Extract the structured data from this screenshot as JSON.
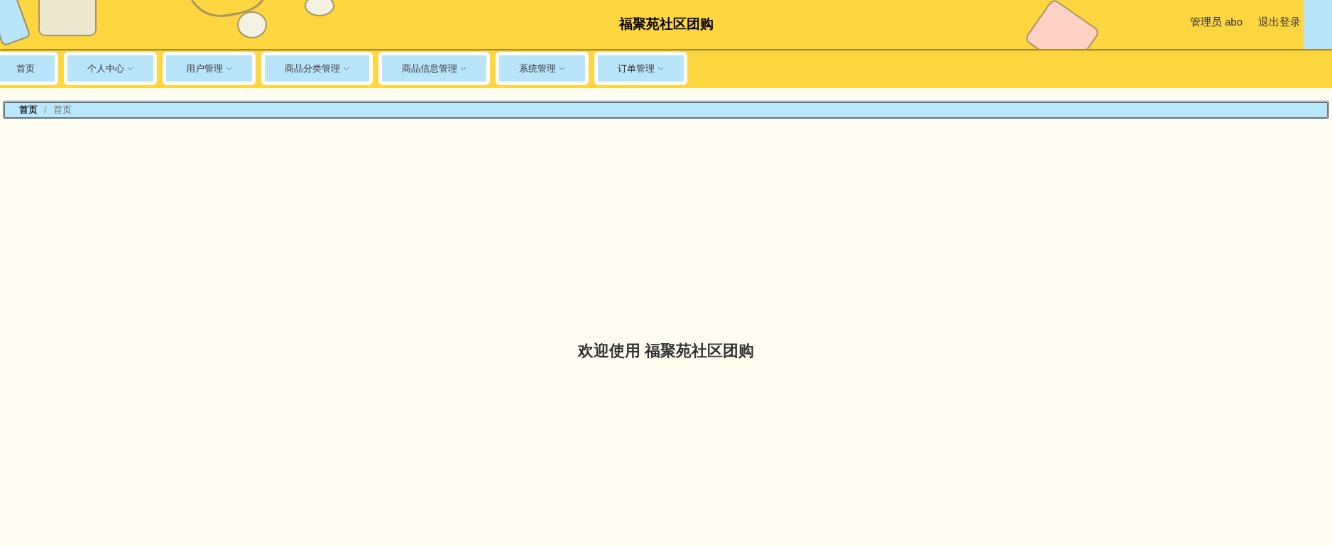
{
  "header": {
    "title": "福聚苑社区团购",
    "user": "管理员 abo",
    "logout": "退出登录"
  },
  "menu": [
    {
      "label": "首页",
      "dropdown": false
    },
    {
      "label": "个人中心",
      "dropdown": true
    },
    {
      "label": "用户管理",
      "dropdown": true
    },
    {
      "label": "商品分类管理",
      "dropdown": true
    },
    {
      "label": "商品信息管理",
      "dropdown": true
    },
    {
      "label": "系统管理",
      "dropdown": true
    },
    {
      "label": "订单管理",
      "dropdown": true
    }
  ],
  "breadcrumb": [
    {
      "label": "首页",
      "current": false
    },
    {
      "separator": "/",
      "label": "首页",
      "current": true
    }
  ],
  "welcome": "欢迎使用 福聚苑社区团购"
}
